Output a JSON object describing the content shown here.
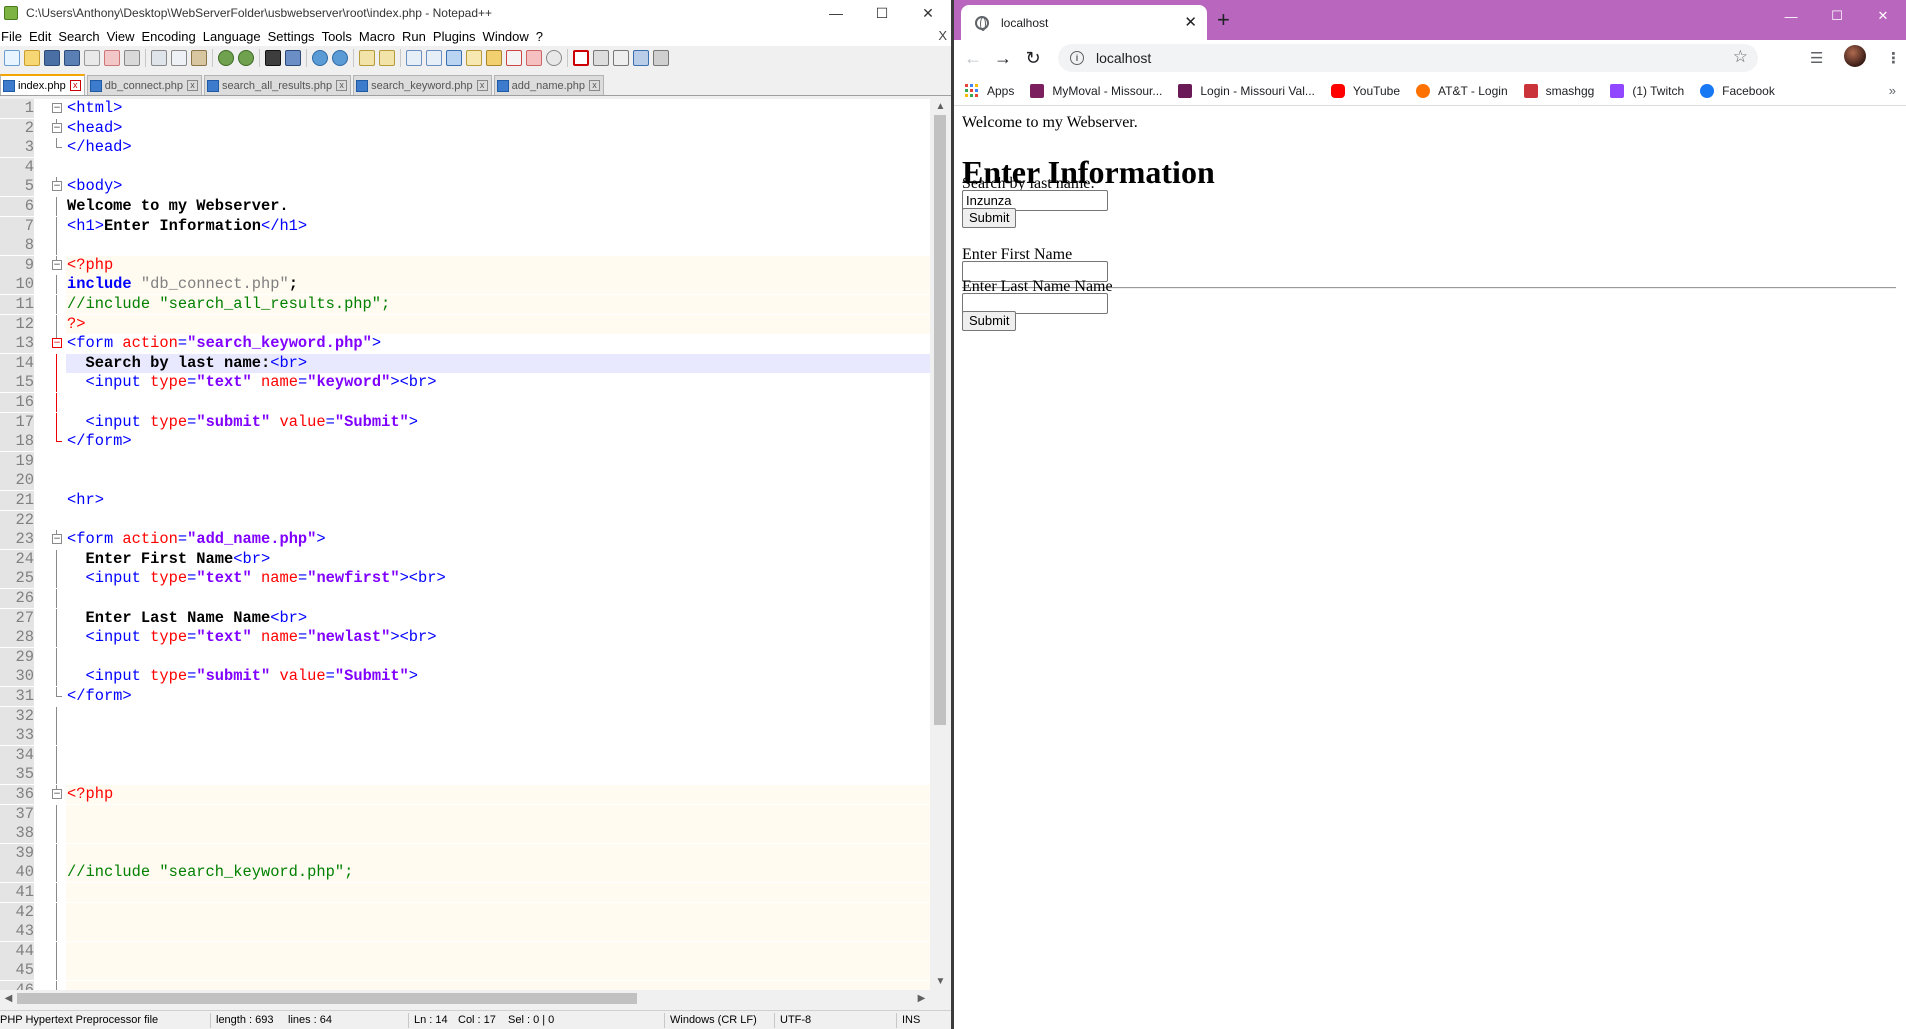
{
  "notepad": {
    "title": "C:\\Users\\Anthony\\Desktop\\WebServerFolder\\usbwebserver\\root\\index.php - Notepad++",
    "menu": [
      "File",
      "Edit",
      "Search",
      "View",
      "Encoding",
      "Language",
      "Settings",
      "Tools",
      "Macro",
      "Run",
      "Plugins",
      "Window",
      "?"
    ],
    "menu_close": "X",
    "tabs": [
      "index.php",
      "db_connect.php",
      "search_all_results.php",
      "search_keyword.php",
      "add_name.php"
    ],
    "active_tab": "index.php",
    "current_line": 14,
    "code_lines": [
      [
        [
          "t-tag",
          "<html>"
        ]
      ],
      [
        [
          "t-tag",
          "<head>"
        ]
      ],
      [
        [
          "t-tag",
          "</head>"
        ]
      ],
      [],
      [
        [
          "t-tag",
          "<body>"
        ]
      ],
      [
        [
          "t-txt",
          "Welcome to my Webserver."
        ]
      ],
      [
        [
          "t-tag",
          "<h1>"
        ],
        [
          "t-txt",
          "Enter Information"
        ],
        [
          "t-tag",
          "</h1>"
        ]
      ],
      [],
      [
        [
          "t-php",
          "<?php"
        ]
      ],
      [
        [
          "t-kw",
          "include"
        ],
        [
          "t-txt",
          " "
        ],
        [
          "t-str",
          "\"db_connect.php\""
        ],
        [
          "t-txt",
          ";"
        ]
      ],
      [
        [
          "t-cmt",
          "//include \"search_all_results.php\";"
        ]
      ],
      [
        [
          "t-php",
          "?>"
        ]
      ],
      [
        [
          "t-tag",
          "<form "
        ],
        [
          "t-attr",
          "action"
        ],
        [
          "t-tag",
          "="
        ],
        [
          "t-val",
          "\"search_keyword.php\""
        ],
        [
          "t-tag",
          ">"
        ]
      ],
      [
        [
          "t-txt",
          "  Search by last name:"
        ],
        [
          "t-tag",
          "<br>"
        ]
      ],
      [
        [
          "t-tag",
          "  <input "
        ],
        [
          "t-attr",
          "type"
        ],
        [
          "t-tag",
          "="
        ],
        [
          "t-val",
          "\"text\""
        ],
        [
          "t-tag",
          " "
        ],
        [
          "t-attr",
          "name"
        ],
        [
          "t-tag",
          "="
        ],
        [
          "t-val",
          "\"keyword\""
        ],
        [
          "t-tag",
          "><br>"
        ]
      ],
      [],
      [
        [
          "t-tag",
          "  <input "
        ],
        [
          "t-attr",
          "type"
        ],
        [
          "t-tag",
          "="
        ],
        [
          "t-val",
          "\"submit\""
        ],
        [
          "t-tag",
          " "
        ],
        [
          "t-attr",
          "value"
        ],
        [
          "t-tag",
          "="
        ],
        [
          "t-val",
          "\"Submit\""
        ],
        [
          "t-tag",
          ">"
        ]
      ],
      [
        [
          "t-tag",
          "</form>"
        ]
      ],
      [],
      [],
      [
        [
          "t-tag",
          "<hr>"
        ]
      ],
      [],
      [
        [
          "t-tag",
          "<form "
        ],
        [
          "t-attr",
          "action"
        ],
        [
          "t-tag",
          "="
        ],
        [
          "t-val",
          "\"add_name.php\""
        ],
        [
          "t-tag",
          ">"
        ]
      ],
      [
        [
          "t-txt",
          "  Enter First Name"
        ],
        [
          "t-tag",
          "<br>"
        ]
      ],
      [
        [
          "t-tag",
          "  <input "
        ],
        [
          "t-attr",
          "type"
        ],
        [
          "t-tag",
          "="
        ],
        [
          "t-val",
          "\"text\""
        ],
        [
          "t-tag",
          " "
        ],
        [
          "t-attr",
          "name"
        ],
        [
          "t-tag",
          "="
        ],
        [
          "t-val",
          "\"newfirst\""
        ],
        [
          "t-tag",
          "><br>"
        ]
      ],
      [],
      [
        [
          "t-txt",
          "  Enter Last Name Name"
        ],
        [
          "t-tag",
          "<br>"
        ]
      ],
      [
        [
          "t-tag",
          "  <input "
        ],
        [
          "t-attr",
          "type"
        ],
        [
          "t-tag",
          "="
        ],
        [
          "t-val",
          "\"text\""
        ],
        [
          "t-tag",
          " "
        ],
        [
          "t-attr",
          "name"
        ],
        [
          "t-tag",
          "="
        ],
        [
          "t-val",
          "\"newlast\""
        ],
        [
          "t-tag",
          "><br>"
        ]
      ],
      [],
      [
        [
          "t-tag",
          "  <input "
        ],
        [
          "t-attr",
          "type"
        ],
        [
          "t-tag",
          "="
        ],
        [
          "t-val",
          "\"submit\""
        ],
        [
          "t-tag",
          " "
        ],
        [
          "t-attr",
          "value"
        ],
        [
          "t-tag",
          "="
        ],
        [
          "t-val",
          "\"Submit\""
        ],
        [
          "t-tag",
          ">"
        ]
      ],
      [
        [
          "t-tag",
          "</form>"
        ]
      ],
      [],
      [],
      [],
      [],
      [
        [
          "t-php",
          "<?php"
        ]
      ],
      [],
      [],
      [],
      [
        [
          "t-cmt",
          "//include \"search_keyword.php\";"
        ]
      ],
      [],
      [],
      [],
      [],
      [],
      [],
      []
    ],
    "php_lines": [
      9,
      10,
      11,
      12,
      36,
      37,
      38,
      39,
      40,
      41,
      42,
      43,
      44,
      45,
      46,
      47
    ],
    "status": {
      "filetype": "PHP Hypertext Preprocessor file",
      "length": "length : 693",
      "lines": "lines : 64",
      "ln": "Ln : 14",
      "col": "Col : 17",
      "sel": "Sel : 0 | 0",
      "eol": "Windows (CR LF)",
      "encoding": "UTF-8",
      "mode": "INS"
    }
  },
  "chrome": {
    "tab_title": "localhost",
    "url": "localhost",
    "accent": "#b966bf",
    "bookmarks": [
      {
        "label": "Apps",
        "icon": "apps-grid-icon"
      },
      {
        "label": "MyMoval - Missour...",
        "icon": "mymoval-icon",
        "color": "#7b1f5f"
      },
      {
        "label": "Login - Missouri Val...",
        "icon": "missouri-valley-icon",
        "color": "#6a1b57"
      },
      {
        "label": "YouTube",
        "icon": "youtube-icon",
        "color": "#ff0000"
      },
      {
        "label": "AT&T - Login",
        "icon": "att-icon",
        "color": "#ff7200"
      },
      {
        "label": "smashgg",
        "icon": "smashgg-icon",
        "color": "#cb333b"
      },
      {
        "label": "(1) Twitch",
        "icon": "twitch-icon",
        "color": "#9146ff"
      },
      {
        "label": "Facebook",
        "icon": "facebook-icon",
        "color": "#1877f2"
      }
    ],
    "page": {
      "welcome": "Welcome to my Webserver.",
      "heading": "Enter Information",
      "search_label": "Search by last name:",
      "keyword_value": "Inzunza",
      "submit_label": "Submit",
      "first_label": "Enter First Name",
      "last_label": "Enter Last Name Name",
      "submit2_label": "Submit"
    }
  }
}
